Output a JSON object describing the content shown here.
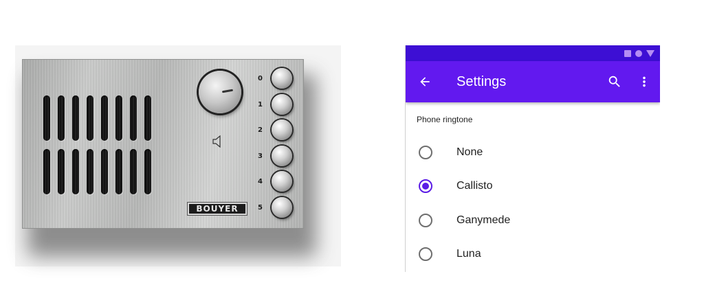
{
  "intercom": {
    "brand": "BOUYER",
    "keys": [
      "0",
      "1",
      "2",
      "3",
      "4",
      "5"
    ]
  },
  "settings": {
    "status_icons": [
      "square-icon",
      "circle-icon",
      "triangle-icon"
    ],
    "title": "Settings",
    "back_icon": "arrow-left-icon",
    "search_icon": "search-icon",
    "more_icon": "more-vert-icon",
    "section_label": "Phone ringtone",
    "options": [
      {
        "label": "None",
        "selected": false
      },
      {
        "label": "Callisto",
        "selected": true
      },
      {
        "label": "Ganymede",
        "selected": false
      },
      {
        "label": "Luna",
        "selected": false
      }
    ],
    "colors": {
      "status_bar": "#3d0fd4",
      "app_bar": "#6219ef",
      "accent": "#5b1ce6"
    }
  }
}
